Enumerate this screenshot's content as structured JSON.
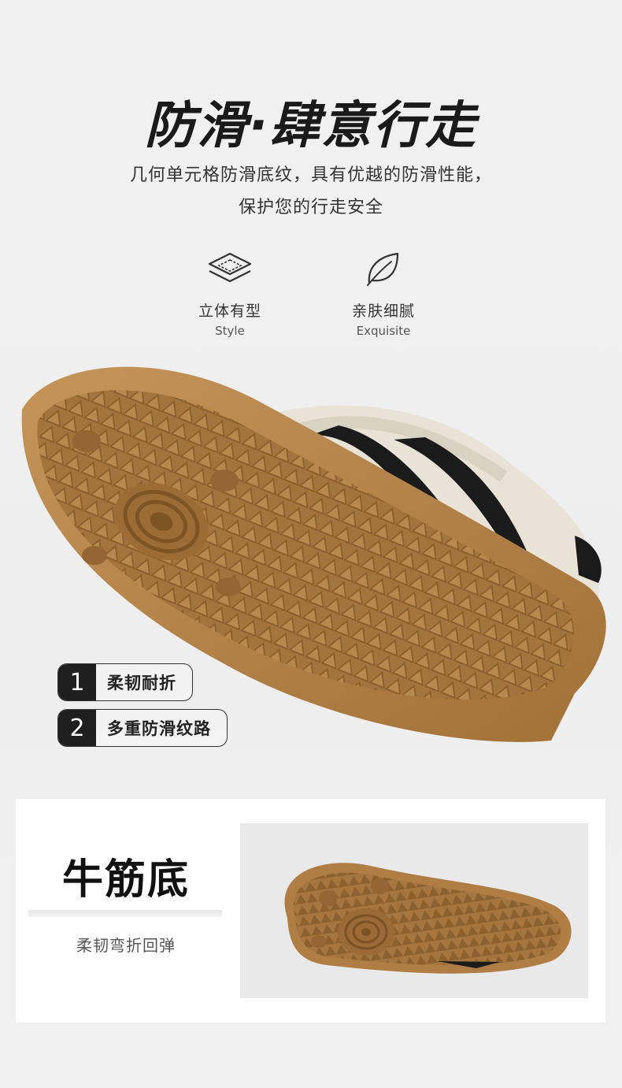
{
  "title": "防滑·肆意行走",
  "description": {
    "line1": "几何单元格防滑底纹，具有优越的防滑性能，",
    "line2": "保护您的行走安全"
  },
  "features": [
    {
      "icon": "layers-icon",
      "cn": "立体有型",
      "en": "Style"
    },
    {
      "icon": "leaf-icon",
      "cn": "亲肤细腻",
      "en": "Exquisite"
    }
  ],
  "tags": [
    {
      "num": "1",
      "label": "柔韧耐折"
    },
    {
      "num": "2",
      "label": "多重防滑纹路"
    }
  ],
  "panel": {
    "title": "牛筋底",
    "subtitle": "柔韧弯折回弹"
  },
  "colors": {
    "sole": "#a6773f",
    "leather": "#e8e3d6",
    "stripe": "#1b1b1b",
    "accent": "#1f1f1f"
  }
}
